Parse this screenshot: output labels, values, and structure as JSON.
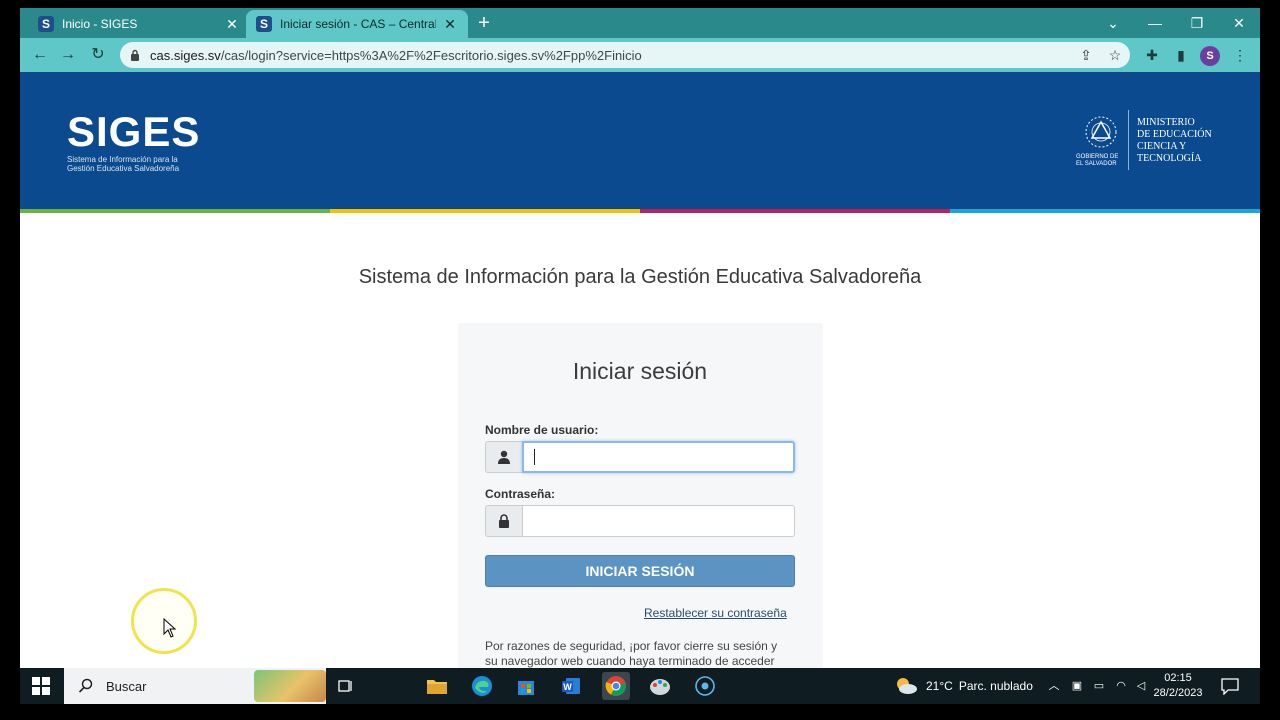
{
  "browser": {
    "tabs": [
      {
        "favicon": "S",
        "title": "Inicio - SIGES",
        "active": false
      },
      {
        "favicon": "S",
        "title": "Iniciar sesión - CAS – Central Aut",
        "active": true
      }
    ],
    "url_host": "cas.siges.sv",
    "url_path": "/cas/login?service=https%3A%2F%2Fescritorio.siges.sv%2Fpp%2Finicio",
    "profile_initial": "S"
  },
  "header": {
    "logo_title": "SIGES",
    "logo_subtitle_line1": "Sistema de Información para la",
    "logo_subtitle_line2": "Gestión Educativa Salvadoreña",
    "gov_label_line1": "GOBIERNO DE",
    "gov_label_line2": "EL SALVADOR",
    "ministry_line1": "Ministerio",
    "ministry_line2": "de Educación",
    "ministry_line3": "Ciencia y",
    "ministry_line4": "Tecnología",
    "stripe_colors": [
      "#6cb33f",
      "#f1c500",
      "#b2245b",
      "#18a6dd"
    ]
  },
  "main": {
    "app_title": "Sistema de Información para la Gestión Educativa Salvadoreña",
    "login_heading": "Iniciar sesión",
    "username_label": "Nombre de usuario:",
    "username_value": "",
    "password_label": "Contraseña:",
    "password_value": "",
    "login_button": "INICIAR SESIÓN",
    "reset_link": "Restablecer su contraseña",
    "security_line1": "Por razones de seguridad, ¡por favor cierre su sesión y",
    "security_line2": "su navegador web cuando haya terminado de acceder"
  },
  "taskbar": {
    "search_placeholder": "Buscar",
    "weather_temp": "21°C",
    "weather_text": "Parc. nublado",
    "time": "02:15",
    "date": "28/2/2023",
    "apps": [
      "task-view-icon",
      "file-explorer-icon",
      "edge-icon",
      "store-icon",
      "word-icon",
      "chrome-icon",
      "paint-icon",
      "media-icon"
    ]
  }
}
